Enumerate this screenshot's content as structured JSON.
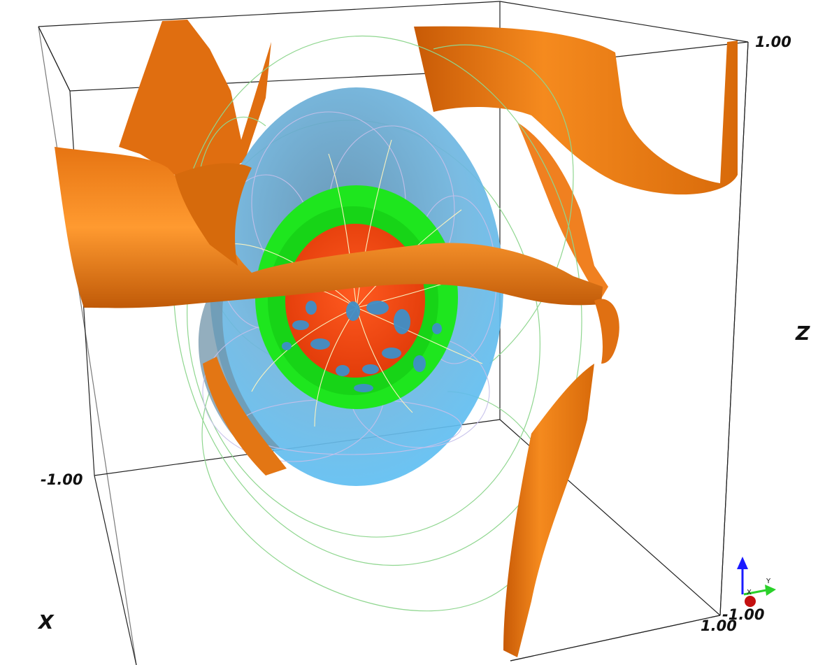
{
  "scene": {
    "ticks": {
      "z_max": "1.00",
      "x_min": "-1.00",
      "z_min": "-1.00",
      "x_max": "1.00"
    },
    "axis_labels": {
      "z": "Z",
      "x": "X"
    },
    "orientation_triad": {
      "y_label": "Y",
      "x_label": "X"
    },
    "colors": {
      "background": "#ffffff",
      "orange_isosurface": "#f07a10",
      "blue_shell": "#5cc0f5",
      "green_shell": "#1ee61e",
      "red_core": "#f04a10",
      "blue_blobs": "#3f8fc8",
      "field_lines_green": "#8fd68f",
      "field_lines_purple": "#b8b0e0",
      "field_lines_yellow": "#f6efb0",
      "bounding_box": "#222222"
    }
  }
}
